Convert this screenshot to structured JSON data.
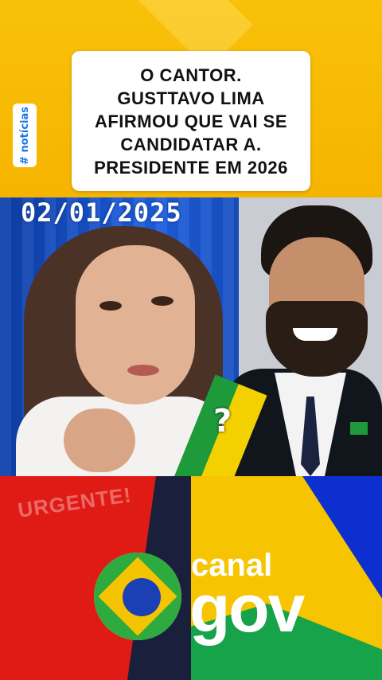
{
  "header": {
    "tag_label": "# notícias",
    "headline": "O CANTOR.\nGUSTTAVO LIMA\nAFIRMOU QUE VAI SE\nCANDIDATAR A.\nPRESIDENTE  EM 2026"
  },
  "photo": {
    "date": "02/01/2025",
    "question_mark": "?"
  },
  "footer": {
    "urgent_label": "URGENTE!",
    "brand_top": "canal",
    "brand_bottom": "gov"
  },
  "colors": {
    "yellow": "#f6c400",
    "red": "#e01b15",
    "blue": "#0d2fd0",
    "green": "#17a34a",
    "tag_text": "#1a73e8"
  }
}
